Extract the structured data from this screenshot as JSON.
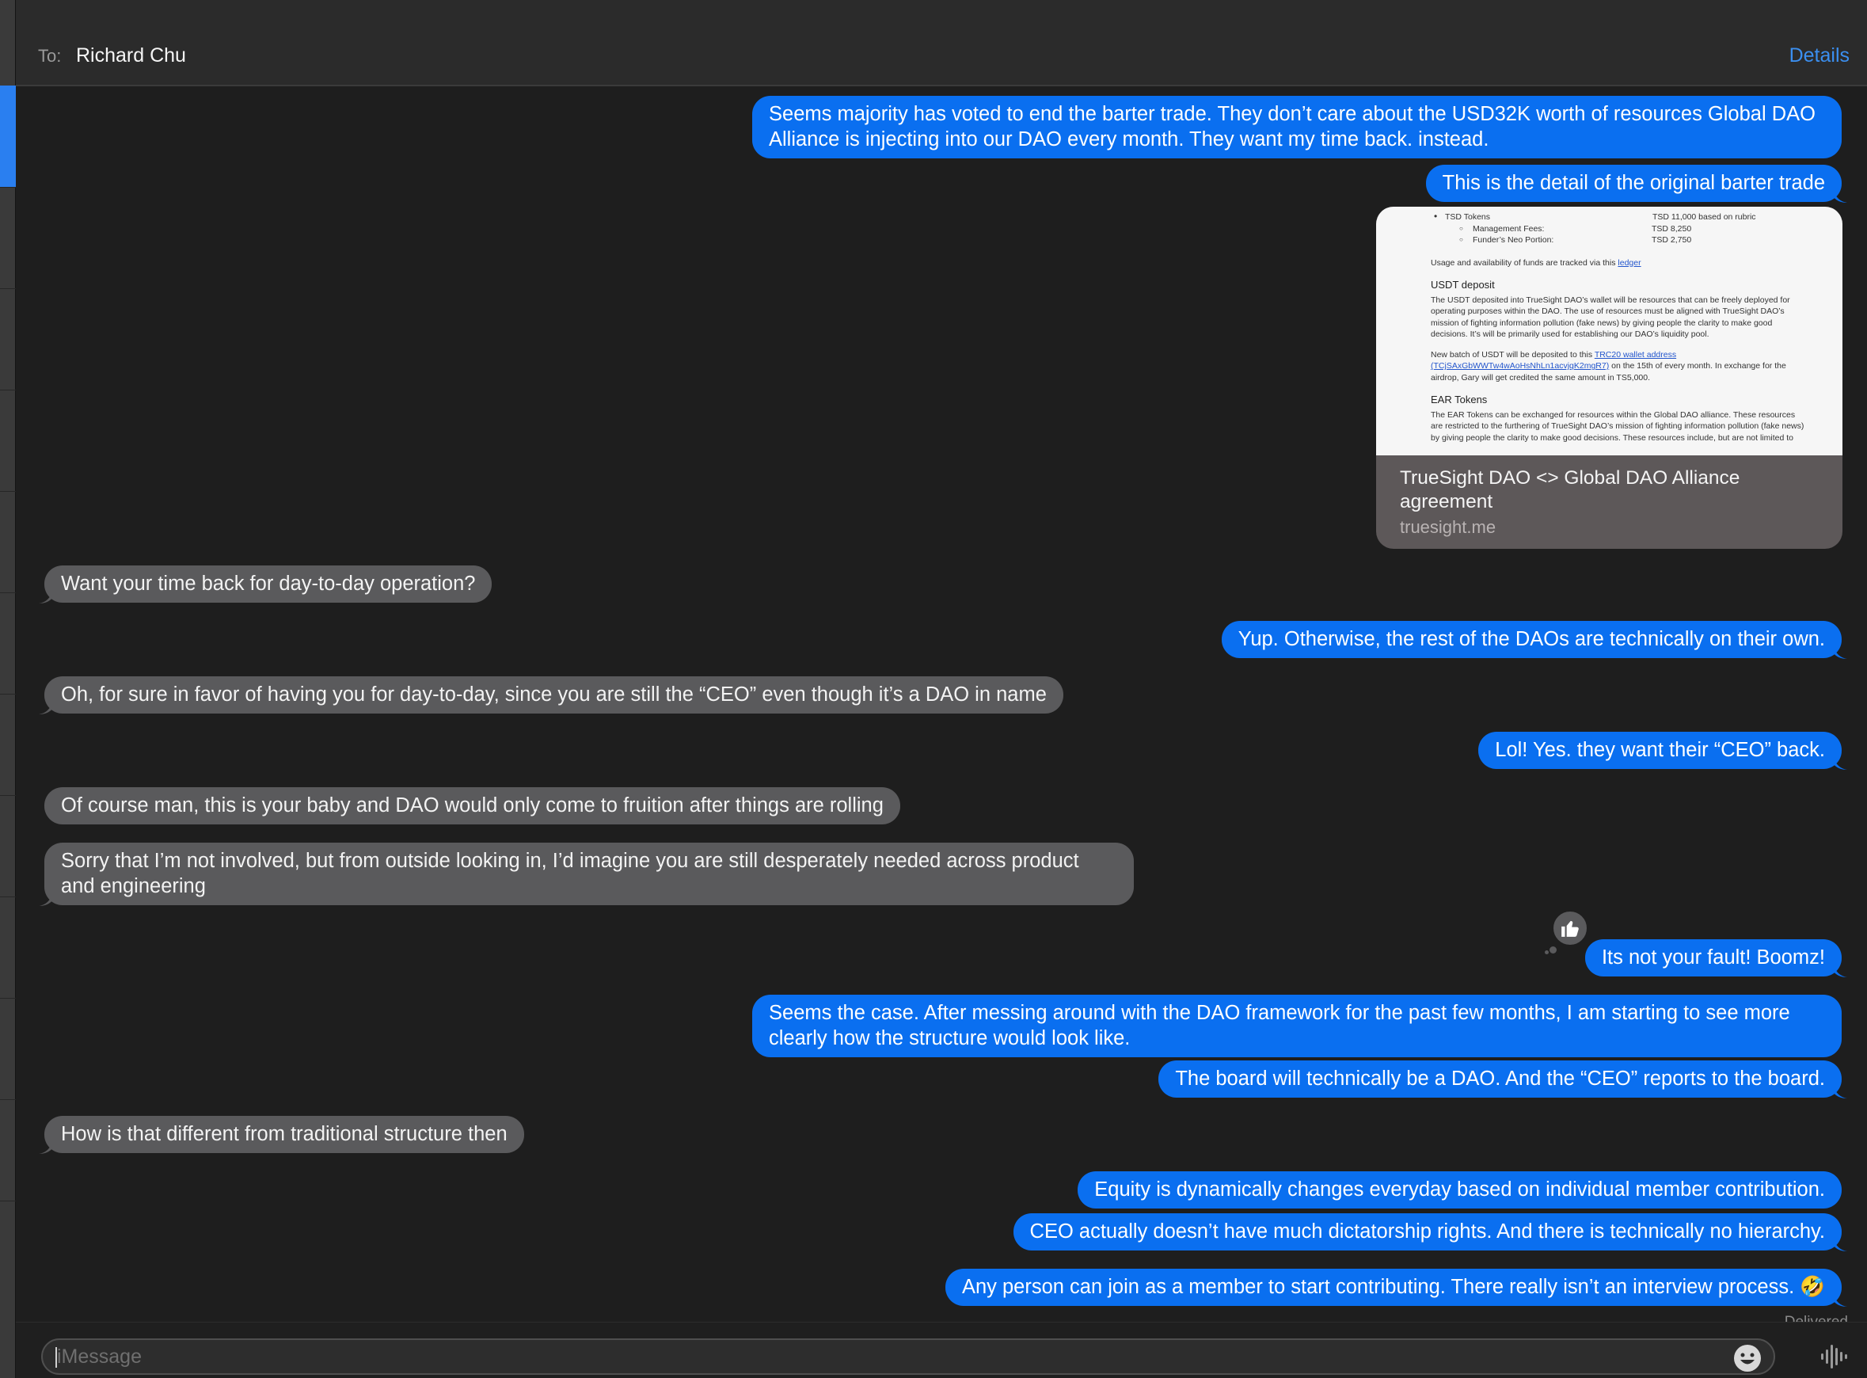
{
  "header": {
    "to_label": "To:",
    "recipient": "Richard Chu",
    "details_label": "Details"
  },
  "messages": [
    {
      "from": "me",
      "text": "Seems majority has voted to end the barter trade. They don’t care about the USD32K worth of resources Global DAO Alliance is injecting into our DAO every month. They want my time back. instead."
    },
    {
      "from": "me",
      "text": "This is the detail of the original barter trade"
    },
    {
      "from": "them",
      "text": "Want your time back for day-to-day operation?"
    },
    {
      "from": "me",
      "text": "Yup. Otherwise, the rest of the DAOs are technically on their own."
    },
    {
      "from": "them",
      "text": "Oh, for sure in favor of having you for day-to-day, since you are still the “CEO” even though it’s a DAO in name"
    },
    {
      "from": "me",
      "text": "Lol! Yes. they want their “CEO” back."
    },
    {
      "from": "them",
      "text": "Of course man, this is your baby and DAO would only come to fruition after things are rolling"
    },
    {
      "from": "them",
      "text": "Sorry that I’m not involved, but from outside looking in, I’d imagine you are still desperately needed across product and engineering"
    },
    {
      "from": "me",
      "text": "Its not your fault! Boomz!"
    },
    {
      "from": "me",
      "text": "Seems the case. After messing around with the DAO framework for the past few months, I am starting to see more clearly how the structure would look like."
    },
    {
      "from": "me",
      "text": "The board will technically be a DAO. And the “CEO” reports to the board."
    },
    {
      "from": "them",
      "text": "How is that different from traditional structure then"
    },
    {
      "from": "me",
      "text": "Equity is dynamically changes everyday based on individual member contribution."
    },
    {
      "from": "me",
      "text": "CEO actually doesn’t have much dictatorship rights. And there is technically no hierarchy."
    },
    {
      "from": "me",
      "text": "Any person can join as a member to start contributing. There really isn’t an interview process. 🤣"
    }
  ],
  "link_preview": {
    "title": "TrueSight DAO <> Global DAO Alliance agreement",
    "domain": "truesight.me",
    "doc": {
      "tokens_label": "TSD Tokens",
      "tokens_value": "TSD 11,000 based on rubric",
      "fee_label": "Management Fees:",
      "fee_value": "TSD 8,250",
      "funder_label": "Funder’s Neo Portion:",
      "funder_value": "TSD 2,750",
      "usage_text": "Usage and availability of funds are tracked via this",
      "usage_link": "ledger",
      "usdt_heading": "USDT deposit",
      "usdt_body": "The USDT deposited into TrueSight DAO’s wallet will be resources that can be freely deployed for operating purposes within the DAO. The use of resources must be aligned with TrueSight DAO’s mission of fighting information pollution (fake news) by giving people the clarity to make good decisions. It’s will be primarily used for establishing our DAO’s liquidity pool.",
      "batch_text_1": "New batch of USDT will be deposited to this",
      "batch_link": "TRC20 wallet address (TCjSAxGbWWTw4wAoHsNhLn1acvjqK2mgR7)",
      "batch_text_2": "on the 15th of every month. In exchange for the airdrop, Gary will get credited the same amount in TS5,000.",
      "ear_heading": "EAR Tokens",
      "ear_body": "The EAR Tokens can be exchanged for resources within the Global DAO alliance. These resources are restricted to the furthering of TrueSight DAO’s mission of fighting information pollution (fake news) by giving people the clarity to make good decisions. These resources include, but are not limited to"
    }
  },
  "status": {
    "delivered": "Delivered"
  },
  "compose": {
    "placeholder": "iMessage",
    "value": ""
  },
  "icons": {
    "tapback": "thumbs-up-icon",
    "emoji": "emoji-icon",
    "audio": "audio-waveform-icon"
  },
  "colors": {
    "outgoing": "#0a6ff0",
    "incoming": "#5a5a5c",
    "accent": "#3b8ff0",
    "background": "#1e1e1e"
  }
}
